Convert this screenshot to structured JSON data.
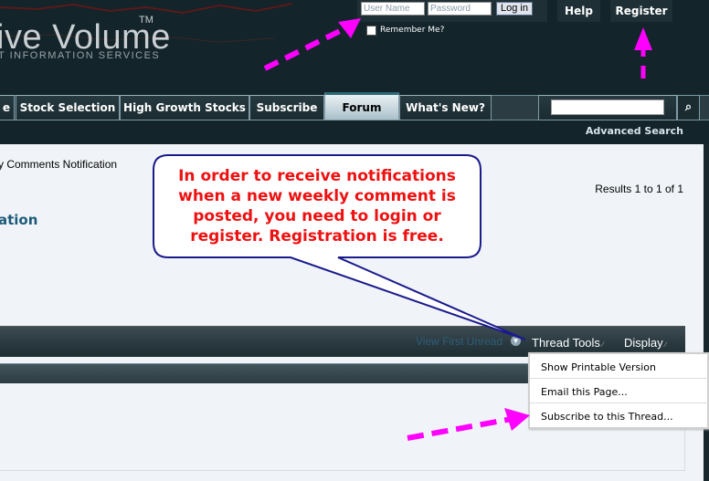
{
  "header": {
    "logo": {
      "text": "ive Volume",
      "tm": "TM",
      "subtitle": "T INFORMATION SERVICES"
    },
    "login": {
      "username_placeholder": "User Name",
      "password_placeholder": "Password",
      "login_label": "Log in",
      "remember_label": "Remember Me?"
    },
    "help_label": "Help",
    "register_label": "Register"
  },
  "nav": {
    "tabs": [
      {
        "label": "e"
      },
      {
        "label": "Stock Selection"
      },
      {
        "label": "High Growth Stocks"
      },
      {
        "label": "Subscribe"
      },
      {
        "label": "Forum",
        "active": true
      },
      {
        "label": "What's New?"
      }
    ],
    "search_icon": "magnifier-icon",
    "advanced_search": "Advanced Search"
  },
  "main": {
    "breadcrumb": "y Comments Notification",
    "title": "ation",
    "results": "Results 1 to 1 of 1",
    "toolbar": {
      "view_first_unread": "View First Unread",
      "thread_tools": "Thread Tools",
      "display": "Display"
    },
    "thread_tools_menu": [
      "Show Printable Version",
      "Email this Page...",
      "Subscribe to this Thread..."
    ]
  },
  "annotation": {
    "callout_lines": [
      "In order to receive notifications",
      "when a new weekly comment is",
      "posted, you need to login or",
      "register. Registration is free."
    ],
    "arrow_color": "#ff00ff",
    "callout_text_color": "#ee1111",
    "callout_border_color": "#1a1a8c"
  },
  "colors": {
    "header_bg": "#13242a",
    "content_bg": "#f0f4f8",
    "title": "#1c5a78"
  }
}
